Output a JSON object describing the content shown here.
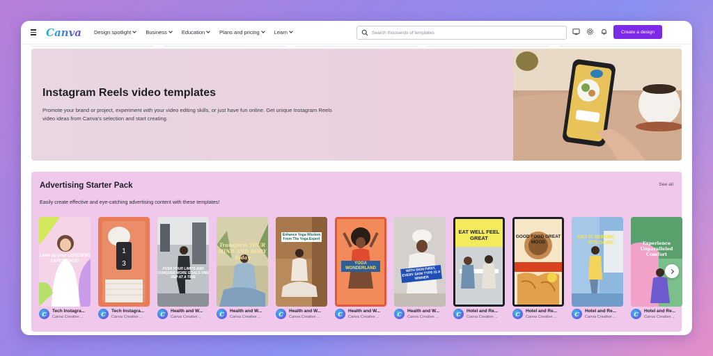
{
  "header": {
    "logo": "Canva",
    "nav": [
      {
        "label": "Design spotlight"
      },
      {
        "label": "Business"
      },
      {
        "label": "Education"
      },
      {
        "label": "Plans and pricing"
      },
      {
        "label": "Learn"
      }
    ],
    "search_placeholder": "Search thousands of templates",
    "icons": [
      "monitor-icon",
      "gear-icon",
      "bell-icon"
    ],
    "create_button": "Create a design"
  },
  "hero": {
    "title": "Instagram Reels video templates",
    "description": "Promote your brand or project, experiment with your video editing skills, or just have fun online. Get unique Instagram Reels video ideas from Canva's selection and start creating."
  },
  "pack": {
    "title": "Advertising Starter Pack",
    "see_all": "See all",
    "description": "Easily create effective and eye-catching advertising content with these templates!",
    "cards": [
      {
        "name": "Tech Instagra...",
        "author": "Canva Creative ...",
        "overlay": "Level up your LISTENING EXPERIENCE!"
      },
      {
        "name": "Tech Instagra...",
        "author": "Canva Creative ...",
        "overlay": ""
      },
      {
        "name": "Health and W...",
        "author": "Canva Creative ...",
        "overlay": "PUSH YOUR LIMITS AND CONQUER MORE GOALS ONE REP AT A TIME"
      },
      {
        "name": "Health and W...",
        "author": "Canva Creative ...",
        "overlay": "Transform YOUR MIND AND BODY Today"
      },
      {
        "name": "Health and W...",
        "author": "Canva Creative ...",
        "overlay": "Enhance Yoga Wisdom From The Yoga Expert"
      },
      {
        "name": "Health and W...",
        "author": "Canva Creative ...",
        "overlay": "YOGA WONDERLAND"
      },
      {
        "name": "Health and W...",
        "author": "Canva Creative ...",
        "overlay": "WITH SKIN FIRST, EVERY SKIN TYPE IS A WINNER"
      },
      {
        "name": "Hotel and Re...",
        "author": "Canva Creative ...",
        "overlay": "EAT WELL FEEL GREAT"
      },
      {
        "name": "Hotel and Re...",
        "author": "Canva Creative ...",
        "overlay": "GOOD FOOD GREAT MOOD"
      },
      {
        "name": "Hotel and Re...",
        "author": "Canva Creative ...",
        "overlay": "GET IT BEFORE IT'S GONE!"
      },
      {
        "name": "Hotel and Re...",
        "author": "Canva Creative ...",
        "overlay": "Experience Unparalleled Comfort"
      }
    ]
  }
}
